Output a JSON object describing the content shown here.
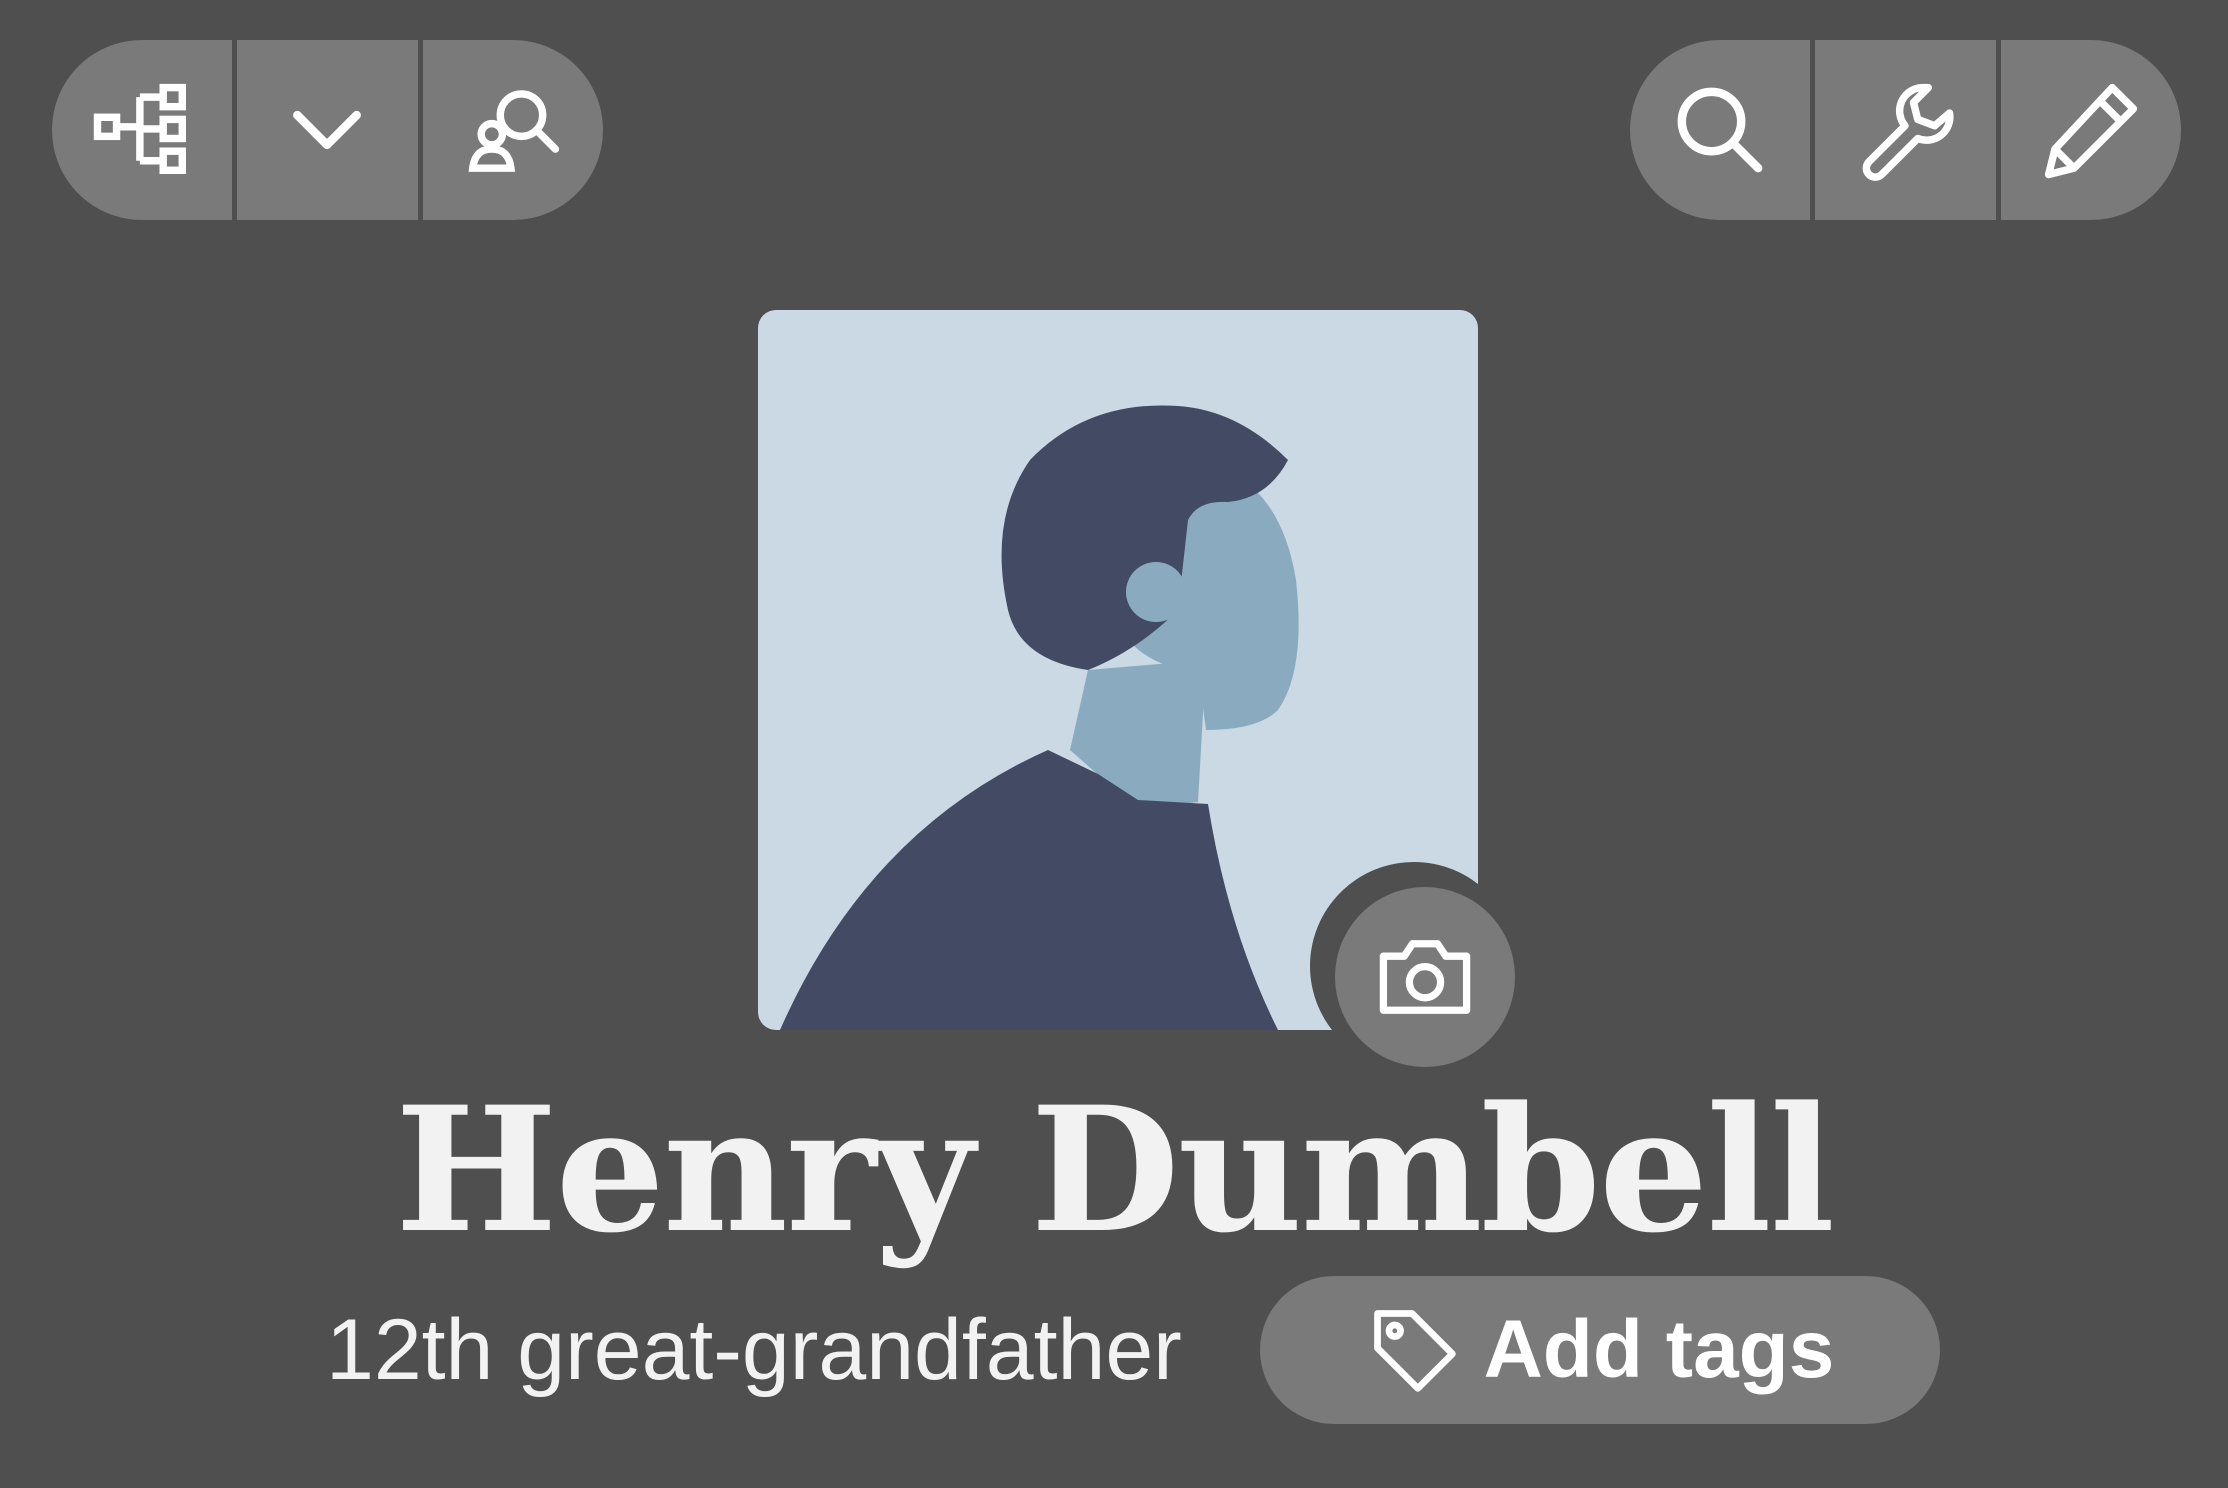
{
  "toolbar_left": {
    "buttons": [
      {
        "name": "family-tree-view-button",
        "icon": "tree-hierarchy-icon"
      },
      {
        "name": "view-options-dropdown-button",
        "icon": "chevron-down-icon"
      },
      {
        "name": "find-person-button",
        "icon": "person-search-icon"
      }
    ]
  },
  "toolbar_right": {
    "buttons": [
      {
        "name": "search-button",
        "icon": "search-icon"
      },
      {
        "name": "tools-button",
        "icon": "wrench-icon"
      },
      {
        "name": "edit-button",
        "icon": "pencil-icon"
      }
    ]
  },
  "profile": {
    "name": "Henry Dumbell",
    "relationship": "12th great-grandfather",
    "photo_icon": "camera-icon",
    "avatar": "silhouette-placeholder"
  },
  "tags": {
    "label": "Add tags",
    "icon": "tag-icon"
  },
  "colors": {
    "background": "#4f4f4f",
    "button": "#7a7a7a",
    "avatar_bg": "#cad9e4",
    "silhouette_dark": "#424b63",
    "silhouette_skin": "#8aabbf",
    "text": "#f2f2f2"
  }
}
